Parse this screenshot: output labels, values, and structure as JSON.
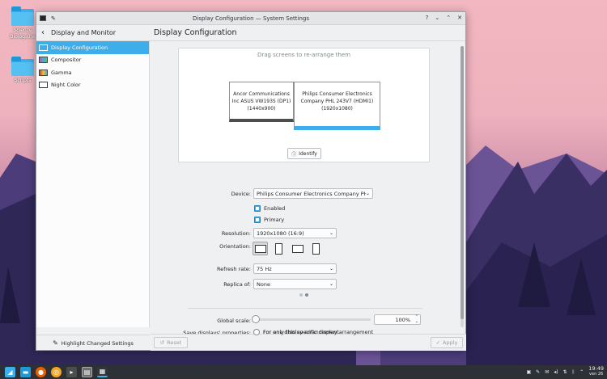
{
  "desktop": {
    "icons": [
      {
        "label": "Scienze Biologiche"
      },
      {
        "label": "Scripts"
      }
    ]
  },
  "window": {
    "title": "Display Configuration — System Settings",
    "controls": {
      "help": "?",
      "minimize": "⌄",
      "maximize": "⌃",
      "close": "✕"
    }
  },
  "header": {
    "back_icon": "‹",
    "section": "Display and Monitor",
    "page_title": "Display Configuration"
  },
  "sidebar": {
    "items": [
      {
        "label": "Display Configuration",
        "icon": "monitor-icon",
        "active": true
      },
      {
        "label": "Compositor",
        "icon": "compositor-icon",
        "active": false
      },
      {
        "label": "Gamma",
        "icon": "gamma-icon",
        "active": false
      },
      {
        "label": "Night Color",
        "icon": "night-color-icon",
        "active": false
      }
    ],
    "footer_label": "Highlight Changed Settings"
  },
  "arrange": {
    "hint": "Drag screens to re-arrange them",
    "screens": [
      {
        "name_line1": "Ancor Communications",
        "name_line2": "Inc ASUS VW193S (DP1)",
        "resolution": "(1440x900)"
      },
      {
        "name_line1": "Philips Consumer Electronics",
        "name_line2": "Company PHL 243V7 (HDMI1)",
        "resolution": "(1920x1080)"
      }
    ],
    "identify_label": "Identify"
  },
  "form": {
    "device_label": "Device:",
    "device_value": "Philips Consumer Electronics Company PHI",
    "enabled_label": "Enabled",
    "primary_label": "Primary",
    "resolution_label": "Resolution:",
    "resolution_value": "1920x1080 (16:9)",
    "orientation_label": "Orientation:",
    "refresh_label": "Refresh rate:",
    "refresh_value": "75 Hz",
    "replica_label": "Replica of:",
    "replica_value": "None",
    "scale_label": "Global scale:",
    "scale_value": "100%",
    "save_label": "Save displays' properties:",
    "save_options": [
      "For any display arrangement",
      "For only this specific display arrangement"
    ]
  },
  "footer": {
    "reset_label": "Reset",
    "apply_label": "Apply"
  },
  "taskbar": {
    "time": "19:49",
    "date": "ven 26"
  },
  "colors": {
    "accent": "#3daee9",
    "window_bg": "#eff0f1",
    "taskbar_bg": "#2d3136"
  }
}
